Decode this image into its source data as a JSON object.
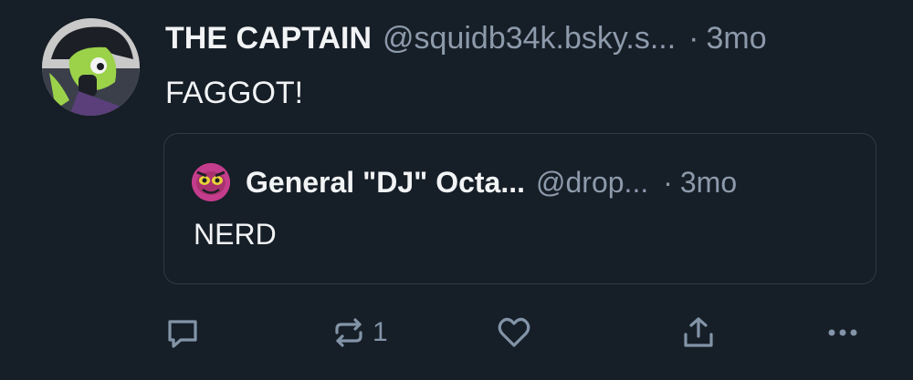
{
  "post": {
    "display_name": "THE CAPTAIN",
    "handle": "@squidb34k.bsky.s...",
    "separator": "·",
    "time": "3mo",
    "text": "FAGGOT!",
    "avatar_icon": "character-avatar-icon"
  },
  "quote": {
    "display_name": "General \"DJ\" Octa...",
    "handle": "@drop...",
    "separator": "·",
    "time": "3mo",
    "text": "NERD",
    "avatar_icon": "octopus-avatar-icon"
  },
  "actions": {
    "reply_icon": "reply-icon",
    "repost_icon": "repost-icon",
    "repost_count": "1",
    "like_icon": "heart-icon",
    "share_icon": "share-icon",
    "more_icon": "more-options-icon"
  },
  "colors": {
    "background": "#161e27",
    "text": "#f1f3f5",
    "muted": "#8d9aab",
    "border": "#2e3a47"
  }
}
